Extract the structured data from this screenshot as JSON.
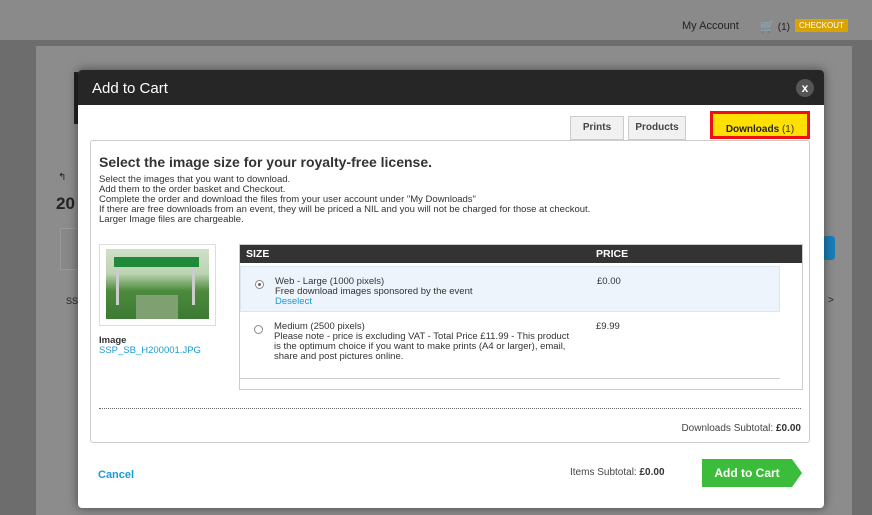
{
  "topbar": {
    "account_label": "My Account",
    "cart_count": "(1)",
    "checkout_label": "CHECKOUT"
  },
  "background": {
    "year_fragment": "20",
    "ss_fragment": "SS",
    "arrow_fragment": "↰",
    "next_fragment": ">"
  },
  "modal": {
    "title": "Add to Cart",
    "close_glyph": "x",
    "tabs": [
      {
        "label": "Prints"
      },
      {
        "label": "Products"
      },
      {
        "label": "Downloads",
        "count": "(1)"
      }
    ],
    "heading": "Select the image size for your royalty-free license.",
    "intro_lines": [
      "Select the images that you want to download.",
      "Add them to the order basket and Checkout.",
      "Complete the order and download the files from your user account under \"My Downloads\"",
      "If there are free downloads from an event, they will be priced a NIL and you will not be charged for those at checkout.",
      "Larger Image files are chargeable."
    ],
    "image": {
      "label": "Image",
      "filename": "SSP_SB_H200001.JPG"
    },
    "table": {
      "headers": {
        "size": "SIZE",
        "price": "PRICE"
      },
      "rows": [
        {
          "title": "Web - Large (1000 pixels)",
          "note": "Free download images sponsored by the event",
          "action": "Deselect",
          "price": "£0.00",
          "selected": true
        },
        {
          "title": "Medium (2500 pixels)",
          "note": "Please note - price is excluding VAT - Total Price £11.99 - This product is the optimum choice if you want to make prints (A4 or larger), email, share and post pictures online.",
          "price": "£9.99",
          "selected": false
        }
      ]
    },
    "downloads_subtotal": {
      "label": "Downloads Subtotal:",
      "value": "£0.00"
    },
    "footer": {
      "cancel_label": "Cancel",
      "items_subtotal_label": "Items Subtotal:",
      "items_subtotal_value": "£0.00",
      "add_to_cart_label": "Add to Cart"
    }
  },
  "colors": {
    "accent_blue": "#1a9bd6",
    "active_tab": "#ffe000",
    "tab_highlight": "#ee1010",
    "add_button": "#3bbd3b",
    "header_dark": "#262626"
  }
}
